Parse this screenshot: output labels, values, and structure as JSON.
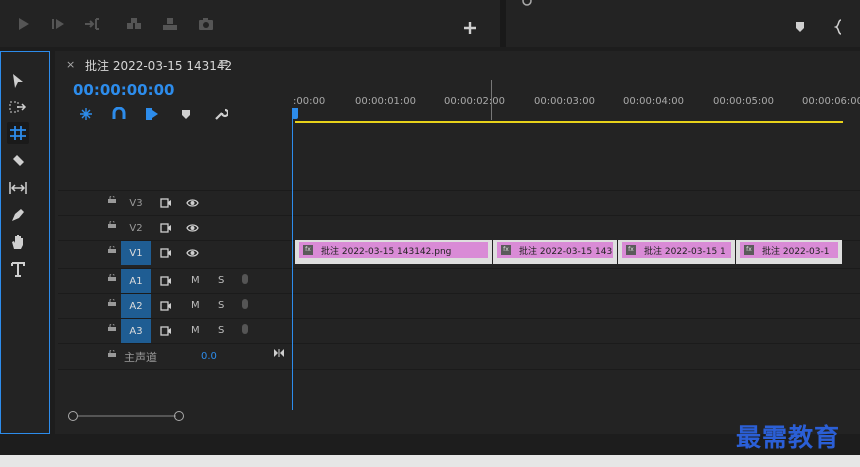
{
  "timeline": {
    "close": "×",
    "title": "批注 2022-03-15 143142",
    "menu": "≡",
    "timecode": "00:00:00:00"
  },
  "ruler": [
    ":00:00",
    "00:00:01:00",
    "00:00:02:00",
    "00:00:03:00",
    "00:00:04:00",
    "00:00:05:00",
    "00:00:06:00"
  ],
  "tracks": {
    "video": [
      {
        "name": "V3"
      },
      {
        "name": "V2"
      },
      {
        "name": "V1"
      }
    ],
    "audio": [
      {
        "name": "A1",
        "m": "M",
        "s": "S"
      },
      {
        "name": "A2",
        "m": "M",
        "s": "S"
      },
      {
        "name": "A3",
        "m": "M",
        "s": "S"
      }
    ],
    "master": {
      "name": "主声道",
      "value": "0.0"
    }
  },
  "clips": [
    {
      "fx": "fx",
      "label": "批注 2022-03-15  143142.png"
    },
    {
      "fx": "fx",
      "label": "批注 2022-03-15 143"
    },
    {
      "fx": "fx",
      "label": "批注 2022-03-15 1"
    },
    {
      "fx": "fx",
      "label": "批注 2022-03-1"
    }
  ],
  "watermark": "最需教育",
  "colors": {
    "accent": "#2d8ceb",
    "clip": "#d98bd6",
    "work_area": "#e8d21a",
    "track_on": "#1f5d93"
  }
}
